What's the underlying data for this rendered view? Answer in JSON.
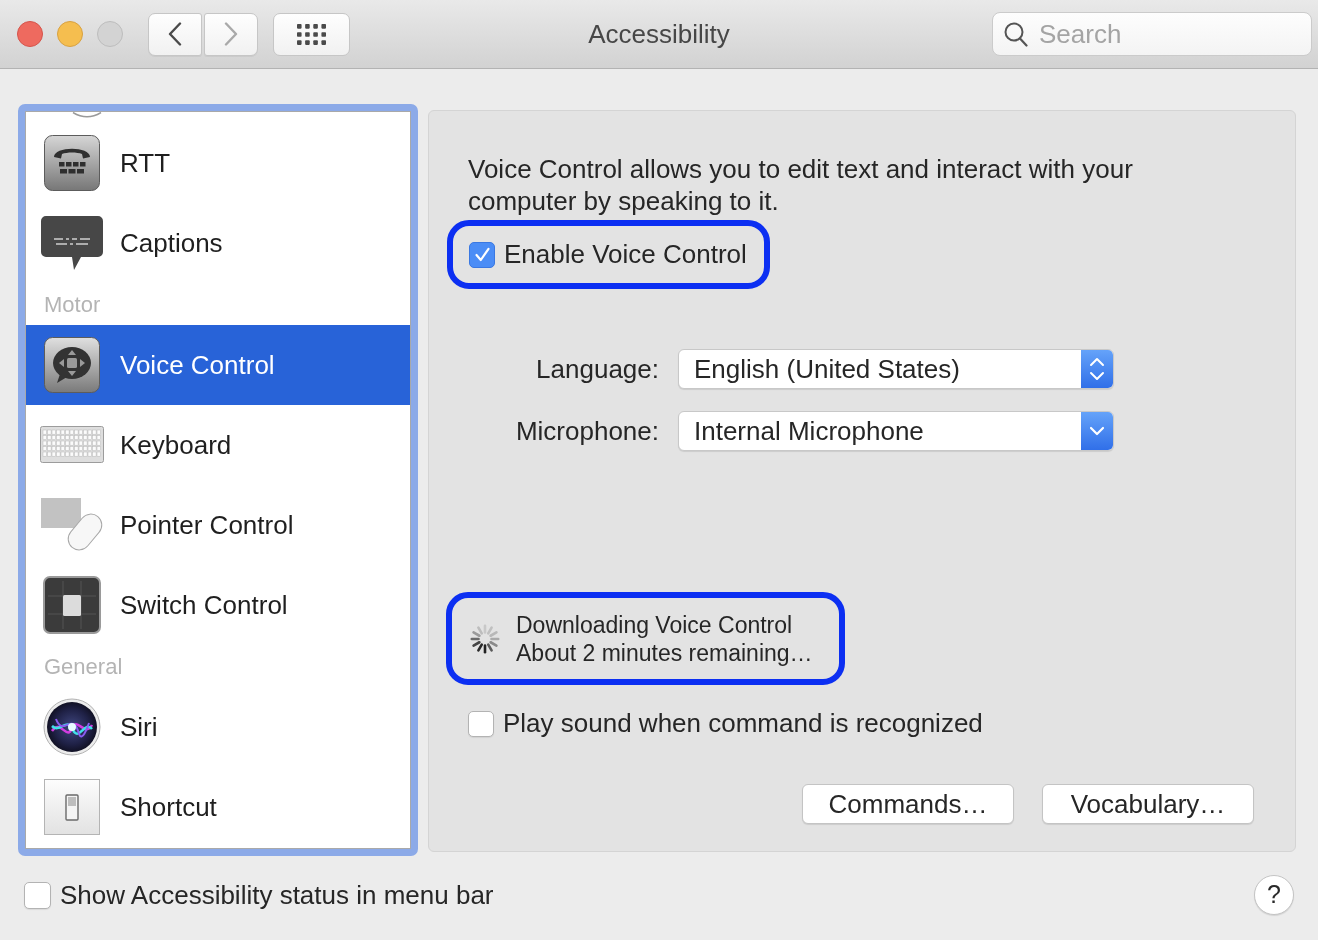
{
  "window": {
    "title": "Accessibility",
    "controls": [
      {
        "kind": "close",
        "disabled": false
      },
      {
        "kind": "minimize",
        "disabled": false
      },
      {
        "kind": "zoom",
        "disabled": true
      }
    ]
  },
  "toolbar": {
    "nav_buttons": [
      {
        "kind": "back",
        "disabled": false
      },
      {
        "kind": "forward",
        "disabled": true
      }
    ]
  },
  "search": {
    "placeholder": "Search"
  },
  "sidebar": {
    "sections": [
      {
        "items": [
          {
            "label": "RTT",
            "selected": false
          },
          {
            "label": "Captions",
            "selected": false
          }
        ]
      },
      {
        "header": "Motor",
        "items": [
          {
            "label": "Voice Control",
            "selected": true
          },
          {
            "label": "Keyboard",
            "selected": false
          },
          {
            "label": "Pointer Control",
            "selected": false
          },
          {
            "label": "Switch Control",
            "selected": false
          }
        ]
      },
      {
        "header": "General",
        "items": [
          {
            "label": "Siri",
            "selected": false
          },
          {
            "label": "Shortcut",
            "selected": false
          }
        ]
      }
    ]
  },
  "panel": {
    "description": "Voice Control allows you to edit text and interact with your computer by speaking to it.",
    "enable_checkbox": {
      "label": "Enable Voice Control",
      "checked": true,
      "highlighted": true
    },
    "fields": [
      {
        "label": "Language:",
        "value": "English (United States)",
        "kind": "stepper"
      },
      {
        "label": "Microphone:",
        "value": "Internal Microphone",
        "kind": "dropdown"
      }
    ],
    "download_status": {
      "title": "Downloading Voice Control",
      "detail": "About 2 minutes remaining…",
      "highlighted": true
    },
    "play_sound_checkbox": {
      "label": "Play sound when command is recognized",
      "checked": false
    },
    "buttons": [
      "Commands…",
      "Vocabulary…"
    ]
  },
  "footer": {
    "status_checkbox": {
      "label": "Show Accessibility status in menu bar",
      "checked": false
    },
    "help_button": "?"
  }
}
